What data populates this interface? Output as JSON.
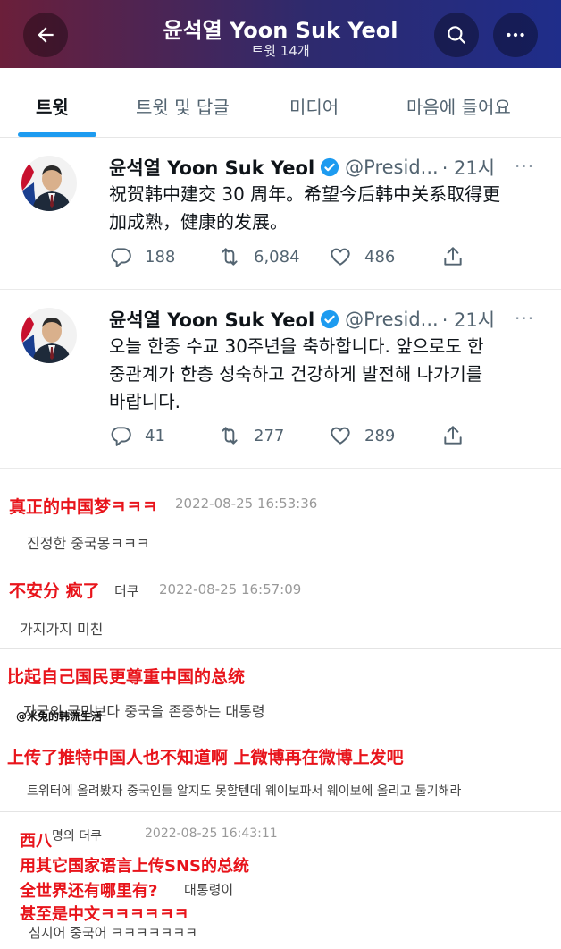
{
  "header": {
    "title": "윤석열 Yoon Suk Yeol",
    "subtitle": "트윗 14개",
    "back_icon": "arrow-left-icon",
    "search_icon": "search-icon",
    "more_icon": "more-horizontal-icon",
    "gradient_colors": [
      "#6b1f3a",
      "#2e2a6e",
      "#1f2d8a"
    ]
  },
  "tabs": [
    {
      "label": "트윗",
      "active": true
    },
    {
      "label": "트윗 및 답글",
      "active": false
    },
    {
      "label": "미디어",
      "active": false
    },
    {
      "label": "마음에 들어요",
      "active": false
    }
  ],
  "accent_color": "#1d9bf0",
  "tweets": [
    {
      "name": "윤석열 Yoon Suk Yeol",
      "handle": "@Presid...",
      "time": "· 21시",
      "more": "···",
      "lines": [
        "祝贺韩中建交 30 周年。希望今后韩中关系取得更",
        "加成熟，健康的发展。"
      ],
      "replies": "188",
      "retweets": "6,084",
      "likes": "486"
    },
    {
      "name": "윤석열 Yoon Suk Yeol",
      "handle": "@Presid...",
      "time": "· 21시",
      "more": "···",
      "lines": [
        "오늘 한중 수교 30주년을 축하합니다. 앞으로도 한",
        "중관계가 한층 성숙하고 건강하게 발전해 나가기를",
        "바랍니다."
      ],
      "replies": "41",
      "retweets": "277",
      "likes": "289"
    }
  ],
  "comments": [
    {
      "annotation": "真正的中国梦ㅋㅋㅋ",
      "date": "2022-08-25 16:53:36",
      "text": "진정한 중국몽ㅋㅋㅋ"
    },
    {
      "annotation": "不安分 疯了",
      "name": "더쿠",
      "date": "2022-08-25 16:57:09",
      "text": "가지가지 미친"
    },
    {
      "annotation": "比起自己国民更尊重中国的总统",
      "text": "자국의 국민보다 중국을 존중하는 대통령",
      "watermark": "@米兔的韩流生活"
    },
    {
      "annotation": "上传了推特中国人也不知道啊 上微博再在微博上发吧",
      "text": "트위터에 올려봤자 중국인들 알지도 못할텐데 웨이보파서 웨이보에 올리고 둘기해라"
    },
    {
      "name": "명의 더쿠",
      "date": "2022-08-25 16:43:11",
      "annotation_lines": [
        "西八",
        "用其它国家语言上传SNS的总统",
        "全世界还有哪里有?",
        "甚至是中文ㅋㅋㅋㅋㅋㅋ"
      ],
      "text_line1": "대통령이",
      "text_line2": "심지어 중국어 ㅋㅋㅋㅋㅋㅋㅋ"
    }
  ]
}
